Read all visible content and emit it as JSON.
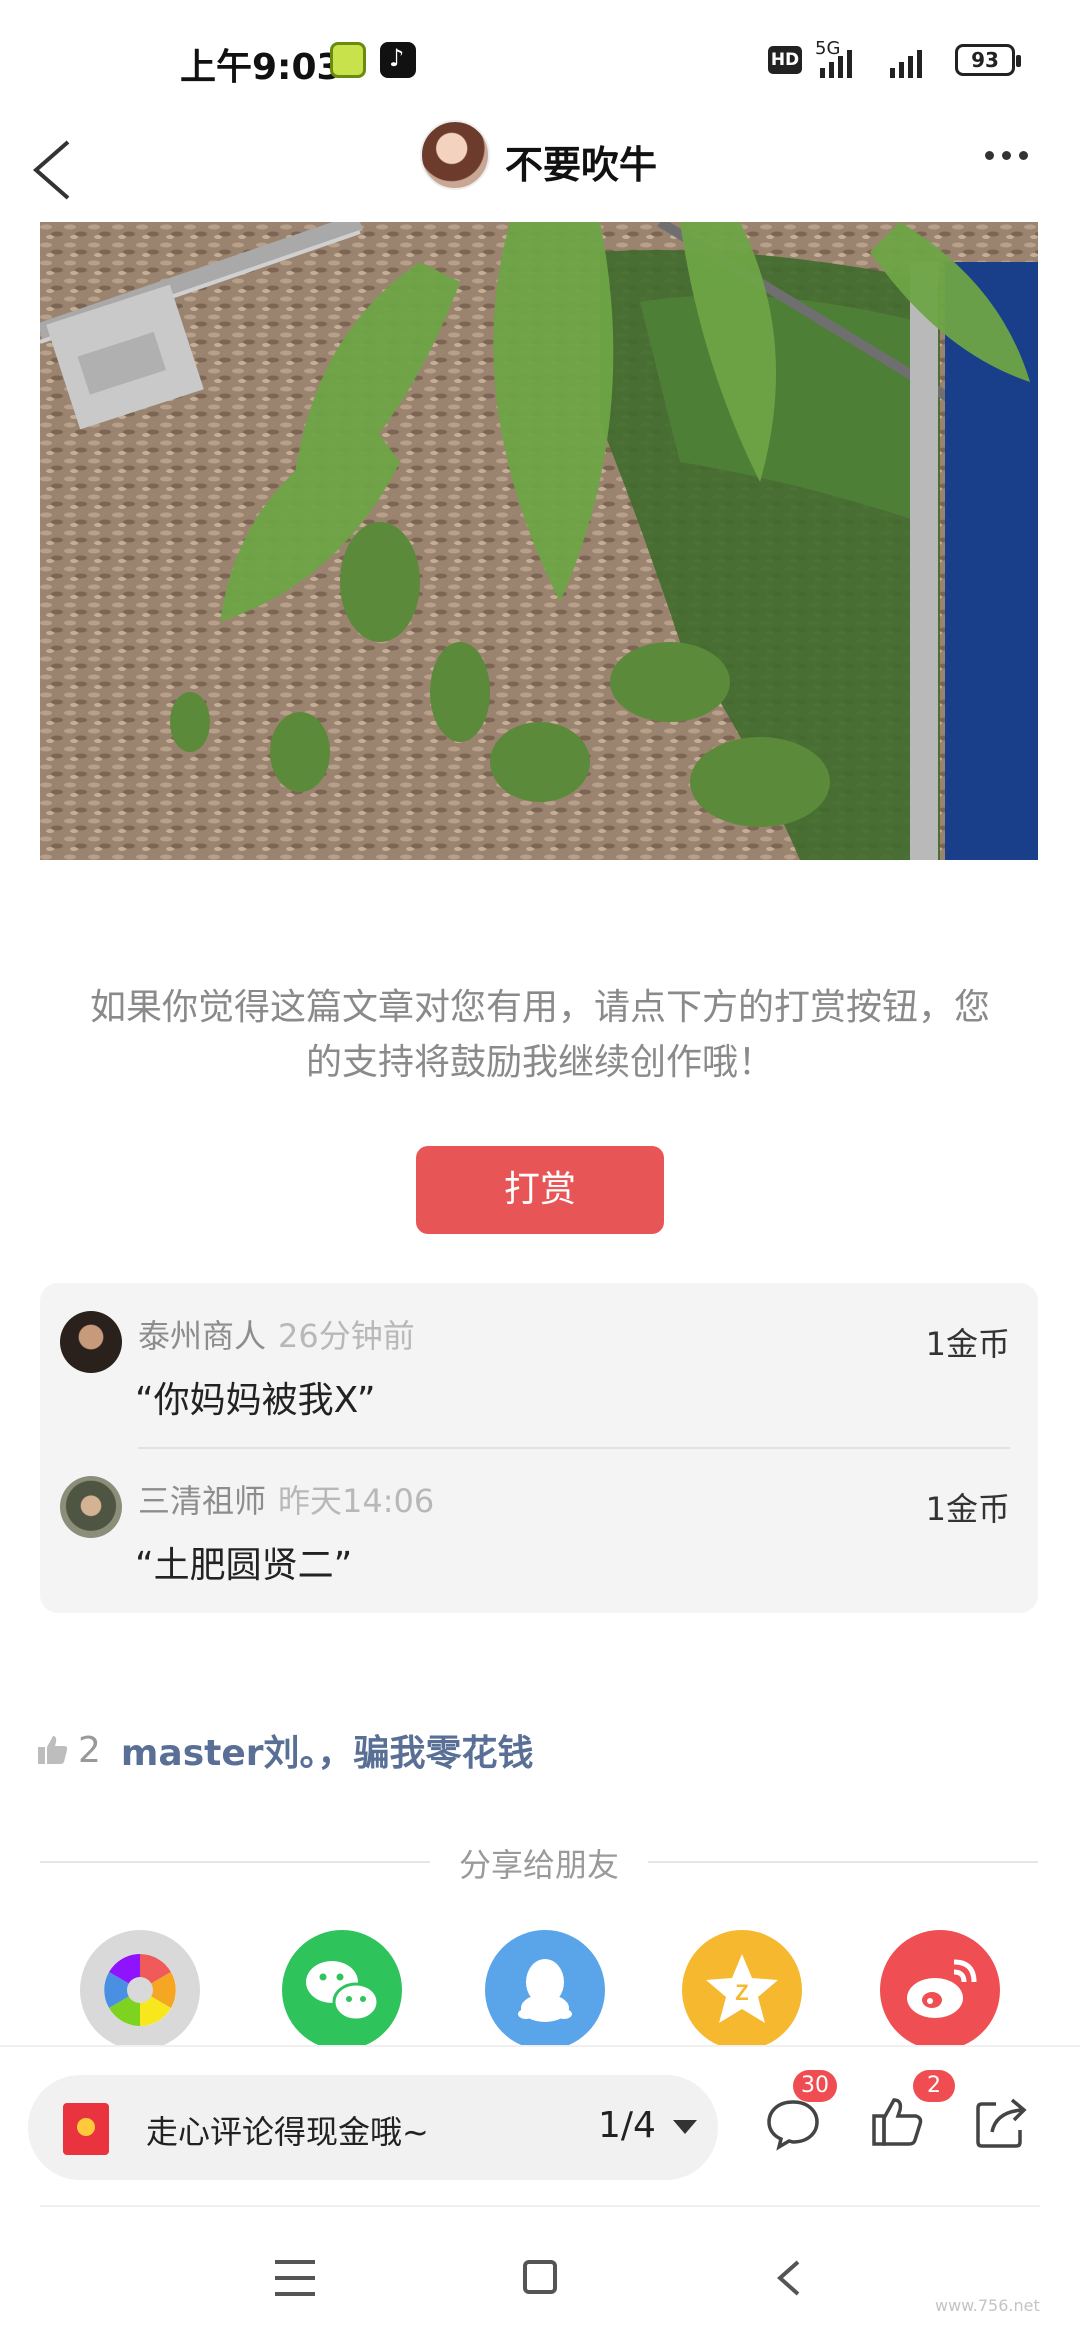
{
  "status_bar": {
    "time": "上午9:03",
    "network": "5G",
    "hd_label": "HD",
    "battery": "93"
  },
  "header": {
    "title": "不要吹牛"
  },
  "article": {
    "image_watermark": "www.756.net"
  },
  "reward": {
    "prompt": "如果你觉得这篇文章对您有用，请点下方的打赏按钮，您的支持将鼓励我继续创作哦！",
    "button_label": "打赏"
  },
  "tips": [
    {
      "name": "泰州商人",
      "time": "26分钟前",
      "amount": "1金币",
      "message": "“你妈妈被我X”"
    },
    {
      "name": "三清祖师",
      "time": "昨天14:06",
      "amount": "1金币",
      "message": "“土肥圆贤二”"
    }
  ],
  "likes": {
    "count": "2",
    "names": "master刘。，骗我零花钱"
  },
  "share": {
    "title": "分享给朋友",
    "targets": [
      "album",
      "wechat",
      "qq",
      "qzone",
      "weibo"
    ]
  },
  "bottom_bar": {
    "comment_placeholder": "走心评论得现金哦~",
    "pager": "1/4",
    "comment_count": "30",
    "like_count": "2"
  },
  "nav": {
    "watermark": "www.756.net"
  },
  "colors": {
    "reward_button": "#e85556",
    "liker_names": "#5a6f96",
    "badge": "#f04d52"
  }
}
